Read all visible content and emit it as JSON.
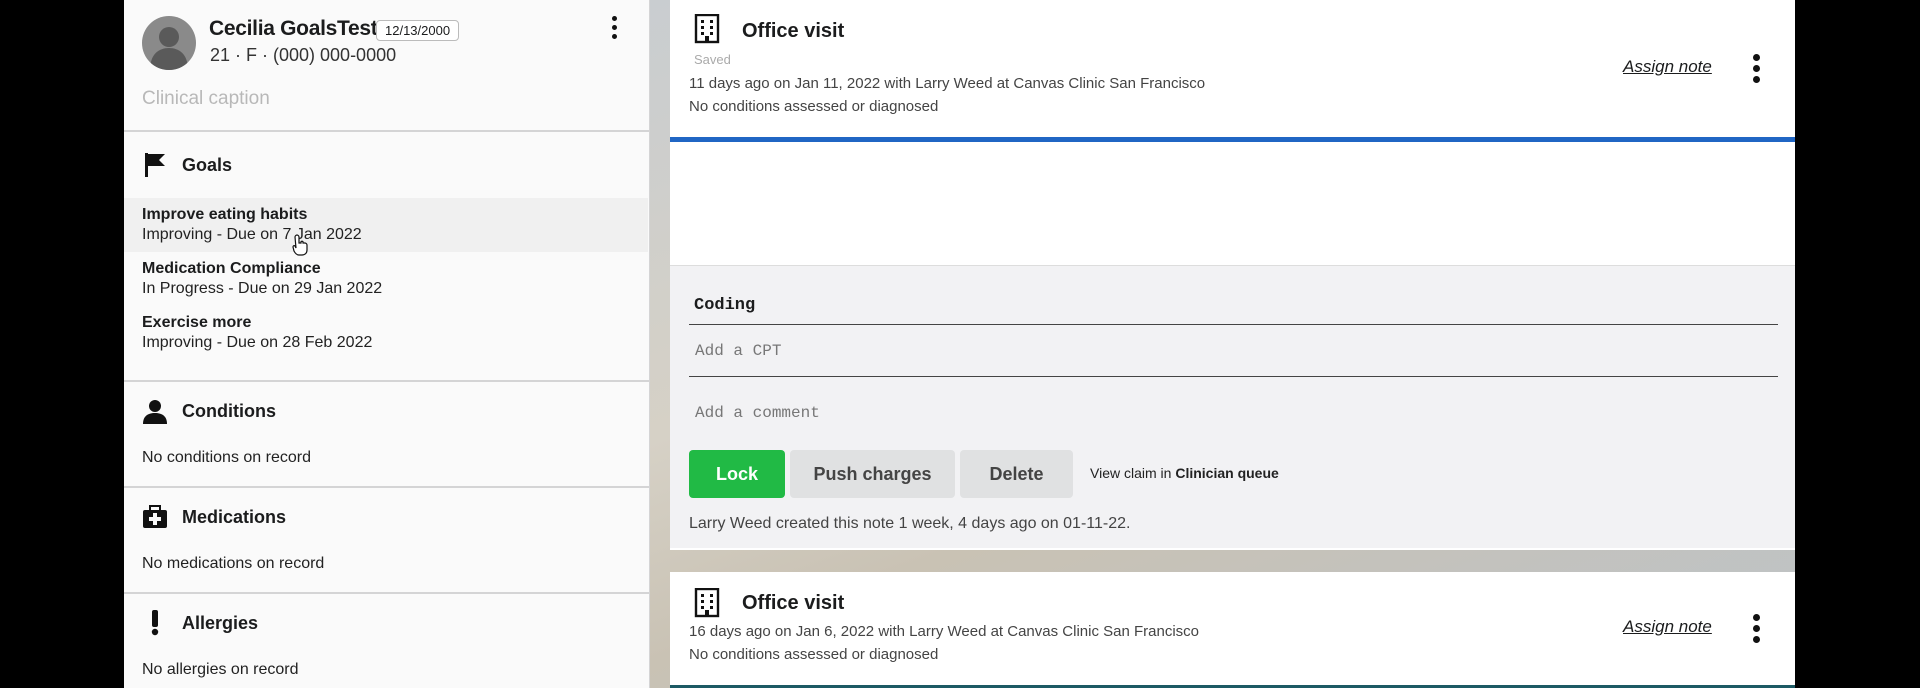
{
  "patient": {
    "name": "Cecilia GoalsTest",
    "dob": "12/13/2000",
    "demographics": "21 · F · (000) 000-0000",
    "caption": "Clinical caption"
  },
  "sections": {
    "goals": {
      "title": "Goals",
      "items": [
        {
          "title": "Improve eating habits",
          "status": "Improving - Due on 7 Jan 2022"
        },
        {
          "title": "Medication Compliance",
          "status": "In Progress - Due on 29 Jan 2022"
        },
        {
          "title": "Exercise more",
          "status": "Improving - Due on 28 Feb 2022"
        }
      ]
    },
    "conditions": {
      "title": "Conditions",
      "empty": "No conditions on record"
    },
    "medications": {
      "title": "Medications",
      "empty": "No medications on record"
    },
    "allergies": {
      "title": "Allergies",
      "empty": "No allergies on record"
    }
  },
  "notes": [
    {
      "title": "Office visit",
      "saved": "Saved",
      "meta": "11 days ago on Jan 11, 2022 with Larry Weed at Canvas Clinic San Francisco",
      "diagnosis": "No conditions assessed or diagnosed",
      "assign": "Assign note",
      "coding": {
        "title": "Coding",
        "cpt_placeholder": "Add a CPT",
        "comment_placeholder": "Add a comment",
        "lock": "Lock",
        "push": "Push charges",
        "delete": "Delete",
        "view_claim_prefix": "View claim in",
        "view_claim_link": "Clinician queue"
      },
      "created": "Larry Weed created this note 1 week, 4 days ago on 01-11-22."
    },
    {
      "title": "Office visit",
      "meta": "16 days ago on Jan 6, 2022 with Larry Weed at Canvas Clinic San Francisco",
      "diagnosis": "No conditions assessed or diagnosed",
      "assign": "Assign note"
    }
  ],
  "colors": {
    "accent_blue": "#2066c4",
    "lock_green": "#21ba45"
  }
}
